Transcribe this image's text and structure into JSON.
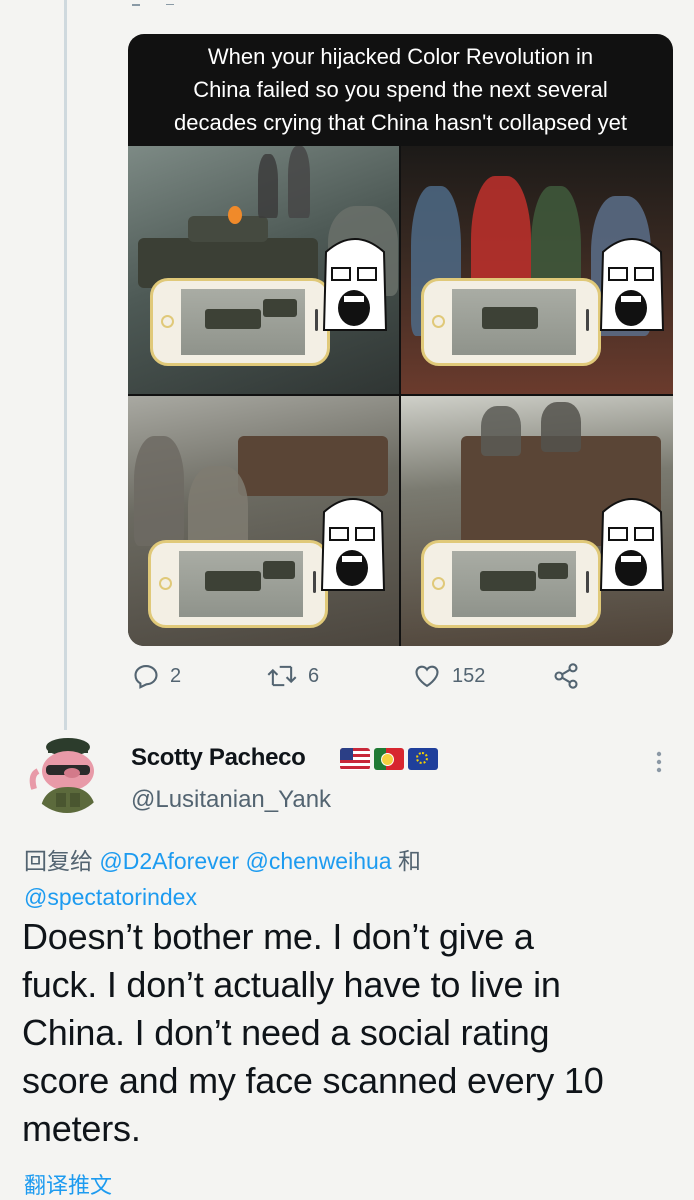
{
  "media": {
    "caption_lines": [
      "When your hijacked Color Revolution in",
      "China failed so you spend the next several",
      "decades crying that China hasn't collapsed yet"
    ]
  },
  "actions": {
    "replies": "2",
    "retweets": "6",
    "likes": "152"
  },
  "reply": {
    "display_name": "Scotty Pacheco",
    "handle": "@Lusitanian_Yank",
    "flags": [
      "us-flag",
      "portugal-flag",
      "eu-flag"
    ],
    "reply_prefix": "回复给",
    "mentions": [
      "@D2Aforever",
      "@chenweihua",
      "@spectatorindex"
    ],
    "conjunction": "和",
    "text_lines": [
      "Doesn’t bother me. I don’t give a",
      "fuck. I don’t actually have to live in",
      "China. I don’t need a social rating",
      "score and my face scanned every 10",
      "meters."
    ],
    "translate_label": "翻译推文"
  },
  "colors": {
    "link": "#1d9bf0",
    "secondary_text": "#536471",
    "background": "#f4f4f2"
  }
}
